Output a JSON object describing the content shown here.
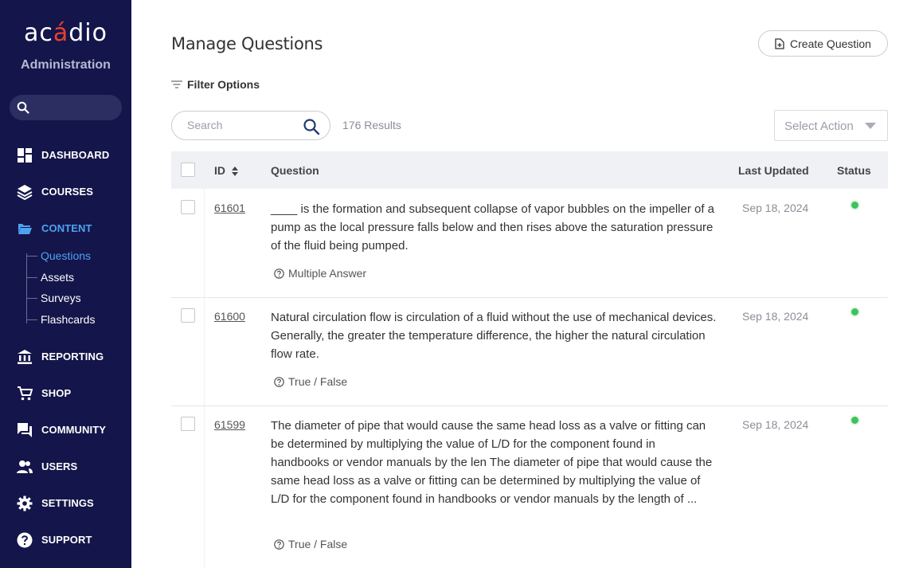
{
  "sidebar": {
    "logo_prefix": "ac",
    "logo_accent": "á",
    "logo_suffix": "dio",
    "subtitle": "Administration",
    "nav": [
      {
        "label": "DASHBOARD",
        "icon": "dashboard-icon"
      },
      {
        "label": "COURSES",
        "icon": "layers-icon"
      },
      {
        "label": "CONTENT",
        "icon": "folder-open-icon",
        "active": true
      },
      {
        "label": "REPORTING",
        "icon": "bank-icon"
      },
      {
        "label": "SHOP",
        "icon": "cart-icon"
      },
      {
        "label": "COMMUNITY",
        "icon": "chat-icon"
      },
      {
        "label": "USERS",
        "icon": "users-icon"
      },
      {
        "label": "SETTINGS",
        "icon": "gear-icon"
      },
      {
        "label": "SUPPORT",
        "icon": "help-icon"
      }
    ],
    "content_sub": [
      "Questions",
      "Assets",
      "Surveys",
      "Flashcards"
    ]
  },
  "header": {
    "title": "Manage Questions",
    "create_label": "Create Question",
    "filter_label": "Filter Options"
  },
  "toolbar": {
    "search_placeholder": "Search",
    "results": "176 Results",
    "select_action": "Select Action"
  },
  "table": {
    "columns": {
      "id": "ID",
      "question": "Question",
      "updated": "Last Updated",
      "status": "Status"
    },
    "rows": [
      {
        "id": "61601",
        "question": "____ is the formation and subsequent collapse of vapor bubbles on the impeller of a pump as the local pressure falls below and then rises above the saturation pressure of the fluid being pumped.",
        "type": "Multiple Answer",
        "updated": "Sep 18, 2024"
      },
      {
        "id": "61600",
        "question": "Natural circulation flow is circulation of a fluid without the use of mechanical devices. Generally, the greater the temperature difference, the higher the natural circulation flow rate.",
        "type": "True / False",
        "updated": "Sep 18, 2024"
      },
      {
        "id": "61599",
        "question": "The diameter of pipe that would cause the same head loss as a valve or fitting can be determined by multiplying the value of L/D for the component found in handbooks or vendor manuals by the len The diameter of pipe that would cause the same head loss as a valve or fitting can be determined by multiplying the value of L/D for the component found in handbooks or vendor manuals by the length of ...",
        "type": "True / False",
        "updated": "Sep 18, 2024"
      }
    ]
  },
  "colors": {
    "sidebar_bg": "#14154a",
    "accent_blue": "#4ea3f1",
    "logo_accent": "#e8412c",
    "status_active": "#3cc35a"
  }
}
